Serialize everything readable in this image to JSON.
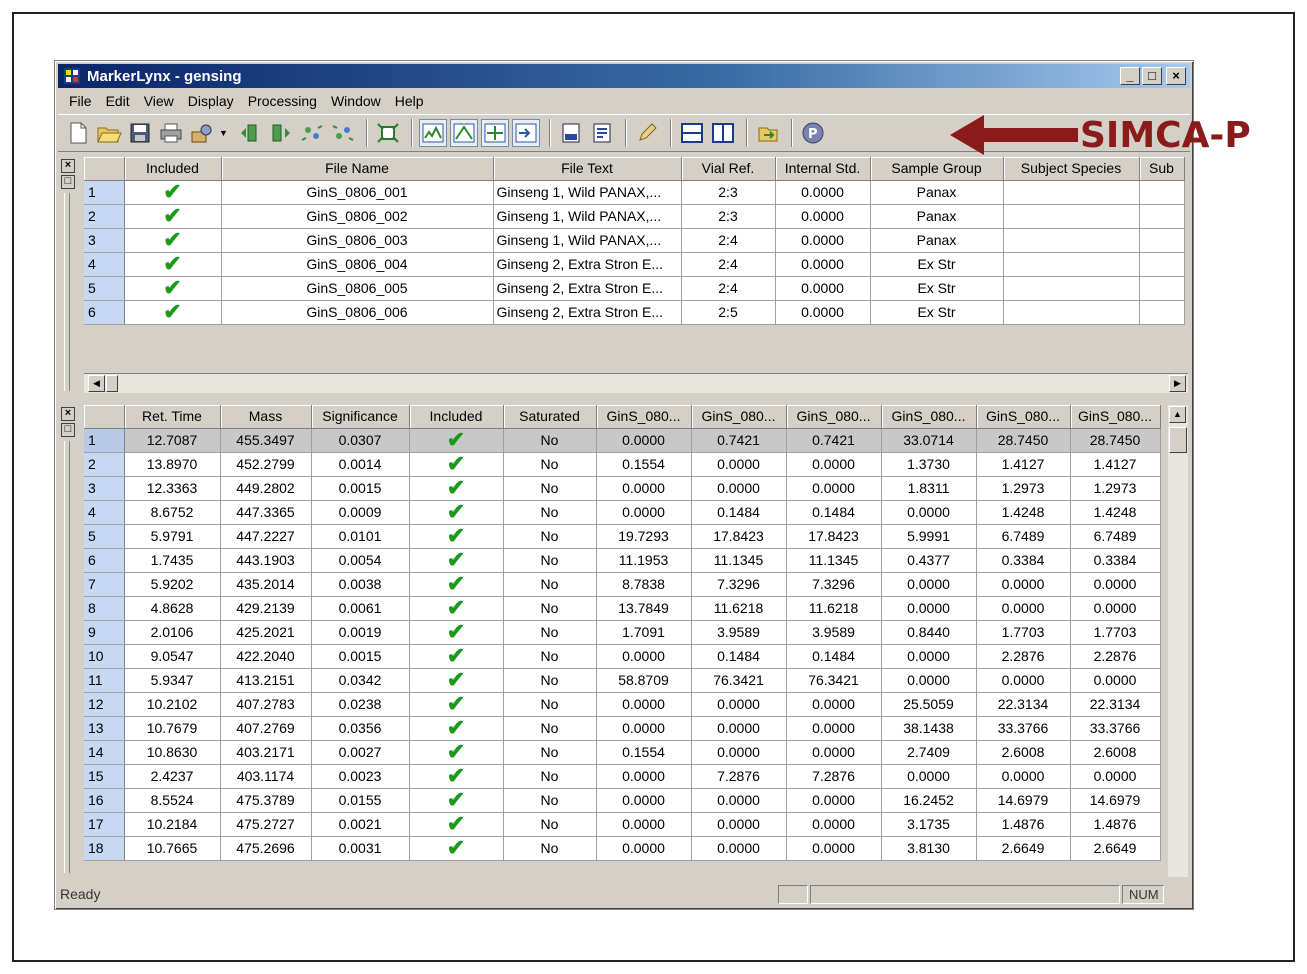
{
  "window": {
    "title": "MarkerLynx - gensing",
    "min_label": "_",
    "max_label": "□",
    "close_label": "×"
  },
  "menu": [
    "File",
    "Edit",
    "View",
    "Display",
    "Processing",
    "Window",
    "Help"
  ],
  "annotation": {
    "label": "SIMCA-P",
    "color": "#8b1a1a"
  },
  "upper_table": {
    "columns": [
      "",
      "Included",
      "File Name",
      "File Text",
      "Vial Ref.",
      "Internal Std.",
      "Sample Group",
      "Subject Species",
      "Sub"
    ],
    "rows": [
      {
        "n": "1",
        "included": true,
        "file_name": "GinS_0806_001",
        "file_text": "Ginseng 1, Wild PANAX,...",
        "vial": "2:3",
        "std": "0.0000",
        "group": "Panax",
        "species": "",
        "sub": ""
      },
      {
        "n": "2",
        "included": true,
        "file_name": "GinS_0806_002",
        "file_text": "Ginseng 1, Wild PANAX,...",
        "vial": "2:3",
        "std": "0.0000",
        "group": "Panax",
        "species": "",
        "sub": ""
      },
      {
        "n": "3",
        "included": true,
        "file_name": "GinS_0806_003",
        "file_text": "Ginseng 1, Wild PANAX,...",
        "vial": "2:4",
        "std": "0.0000",
        "group": "Panax",
        "species": "",
        "sub": ""
      },
      {
        "n": "4",
        "included": true,
        "file_name": "GinS_0806_004",
        "file_text": "Ginseng 2, Extra Stron E...",
        "vial": "2:4",
        "std": "0.0000",
        "group": "Ex Str",
        "species": "",
        "sub": ""
      },
      {
        "n": "5",
        "included": true,
        "file_name": "GinS_0806_005",
        "file_text": "Ginseng 2, Extra Stron E...",
        "vial": "2:4",
        "std": "0.0000",
        "group": "Ex Str",
        "species": "",
        "sub": ""
      },
      {
        "n": "6",
        "included": true,
        "file_name": "GinS_0806_006",
        "file_text": "Ginseng 2, Extra Stron E...",
        "vial": "2:5",
        "std": "0.0000",
        "group": "Ex Str",
        "species": "",
        "sub": ""
      }
    ]
  },
  "lower_table": {
    "columns": [
      "",
      "Ret. Time",
      "Mass",
      "Significance",
      "Included",
      "Saturated",
      "GinS_080...",
      "GinS_080...",
      "GinS_080...",
      "GinS_080...",
      "GinS_080...",
      "GinS_080..."
    ],
    "rows": [
      {
        "n": "1",
        "rt": "12.7087",
        "mass": "455.3497",
        "sig": "0.0307",
        "included": true,
        "sat": "No",
        "v": [
          "0.0000",
          "0.7421",
          "0.7421",
          "33.0714",
          "28.7450",
          "28.7450"
        ]
      },
      {
        "n": "2",
        "rt": "13.8970",
        "mass": "452.2799",
        "sig": "0.0014",
        "included": true,
        "sat": "No",
        "v": [
          "0.1554",
          "0.0000",
          "0.0000",
          "1.3730",
          "1.4127",
          "1.4127"
        ]
      },
      {
        "n": "3",
        "rt": "12.3363",
        "mass": "449.2802",
        "sig": "0.0015",
        "included": true,
        "sat": "No",
        "v": [
          "0.0000",
          "0.0000",
          "0.0000",
          "1.8311",
          "1.2973",
          "1.2973"
        ]
      },
      {
        "n": "4",
        "rt": "8.6752",
        "mass": "447.3365",
        "sig": "0.0009",
        "included": true,
        "sat": "No",
        "v": [
          "0.0000",
          "0.1484",
          "0.1484",
          "0.0000",
          "1.4248",
          "1.4248"
        ]
      },
      {
        "n": "5",
        "rt": "5.9791",
        "mass": "447.2227",
        "sig": "0.0101",
        "included": true,
        "sat": "No",
        "v": [
          "19.7293",
          "17.8423",
          "17.8423",
          "5.9991",
          "6.7489",
          "6.7489"
        ]
      },
      {
        "n": "6",
        "rt": "1.7435",
        "mass": "443.1903",
        "sig": "0.0054",
        "included": true,
        "sat": "No",
        "v": [
          "11.1953",
          "11.1345",
          "11.1345",
          "0.4377",
          "0.3384",
          "0.3384"
        ]
      },
      {
        "n": "7",
        "rt": "5.9202",
        "mass": "435.2014",
        "sig": "0.0038",
        "included": true,
        "sat": "No",
        "v": [
          "8.7838",
          "7.3296",
          "7.3296",
          "0.0000",
          "0.0000",
          "0.0000"
        ]
      },
      {
        "n": "8",
        "rt": "4.8628",
        "mass": "429.2139",
        "sig": "0.0061",
        "included": true,
        "sat": "No",
        "v": [
          "13.7849",
          "11.6218",
          "11.6218",
          "0.0000",
          "0.0000",
          "0.0000"
        ]
      },
      {
        "n": "9",
        "rt": "2.0106",
        "mass": "425.2021",
        "sig": "0.0019",
        "included": true,
        "sat": "No",
        "v": [
          "1.7091",
          "3.9589",
          "3.9589",
          "0.8440",
          "1.7703",
          "1.7703"
        ]
      },
      {
        "n": "10",
        "rt": "9.0547",
        "mass": "422.2040",
        "sig": "0.0015",
        "included": true,
        "sat": "No",
        "v": [
          "0.0000",
          "0.1484",
          "0.1484",
          "0.0000",
          "2.2876",
          "2.2876"
        ]
      },
      {
        "n": "11",
        "rt": "5.9347",
        "mass": "413.2151",
        "sig": "0.0342",
        "included": true,
        "sat": "No",
        "v": [
          "58.8709",
          "76.3421",
          "76.3421",
          "0.0000",
          "0.0000",
          "0.0000"
        ]
      },
      {
        "n": "12",
        "rt": "10.2102",
        "mass": "407.2783",
        "sig": "0.0238",
        "included": true,
        "sat": "No",
        "v": [
          "0.0000",
          "0.0000",
          "0.0000",
          "25.5059",
          "22.3134",
          "22.3134"
        ]
      },
      {
        "n": "13",
        "rt": "10.7679",
        "mass": "407.2769",
        "sig": "0.0356",
        "included": true,
        "sat": "No",
        "v": [
          "0.0000",
          "0.0000",
          "0.0000",
          "38.1438",
          "33.3766",
          "33.3766"
        ]
      },
      {
        "n": "14",
        "rt": "10.8630",
        "mass": "403.2171",
        "sig": "0.0027",
        "included": true,
        "sat": "No",
        "v": [
          "0.1554",
          "0.0000",
          "0.0000",
          "2.7409",
          "2.6008",
          "2.6008"
        ]
      },
      {
        "n": "15",
        "rt": "2.4237",
        "mass": "403.1174",
        "sig": "0.0023",
        "included": true,
        "sat": "No",
        "v": [
          "0.0000",
          "7.2876",
          "7.2876",
          "0.0000",
          "0.0000",
          "0.0000"
        ]
      },
      {
        "n": "16",
        "rt": "8.5524",
        "mass": "475.3789",
        "sig": "0.0155",
        "included": true,
        "sat": "No",
        "v": [
          "0.0000",
          "0.0000",
          "0.0000",
          "16.2452",
          "14.6979",
          "14.6979"
        ]
      },
      {
        "n": "17",
        "rt": "10.2184",
        "mass": "475.2727",
        "sig": "0.0021",
        "included": true,
        "sat": "No",
        "v": [
          "0.0000",
          "0.0000",
          "0.0000",
          "3.1735",
          "1.4876",
          "1.4876"
        ]
      },
      {
        "n": "18",
        "rt": "10.7665",
        "mass": "475.2696",
        "sig": "0.0031",
        "included": true,
        "sat": "No",
        "v": [
          "0.0000",
          "0.0000",
          "0.0000",
          "3.8130",
          "2.6649",
          "2.6649"
        ]
      }
    ]
  },
  "status": {
    "text": "Ready",
    "num": "NUM"
  },
  "toolbar_icons": [
    "new-file-icon",
    "open-folder-icon",
    "save-icon",
    "print-icon",
    "process-icon",
    "first-icon",
    "last-icon",
    "expand-icon",
    "collapse-icon",
    "fit-icon",
    "chromatogram-icon",
    "spectrum-icon",
    "table-icon",
    "import-icon",
    "sample-list-icon",
    "marker-list-icon",
    "edit-icon",
    "split-horizontal-icon",
    "split-vertical-icon",
    "export-icon",
    "simca-p-icon"
  ]
}
